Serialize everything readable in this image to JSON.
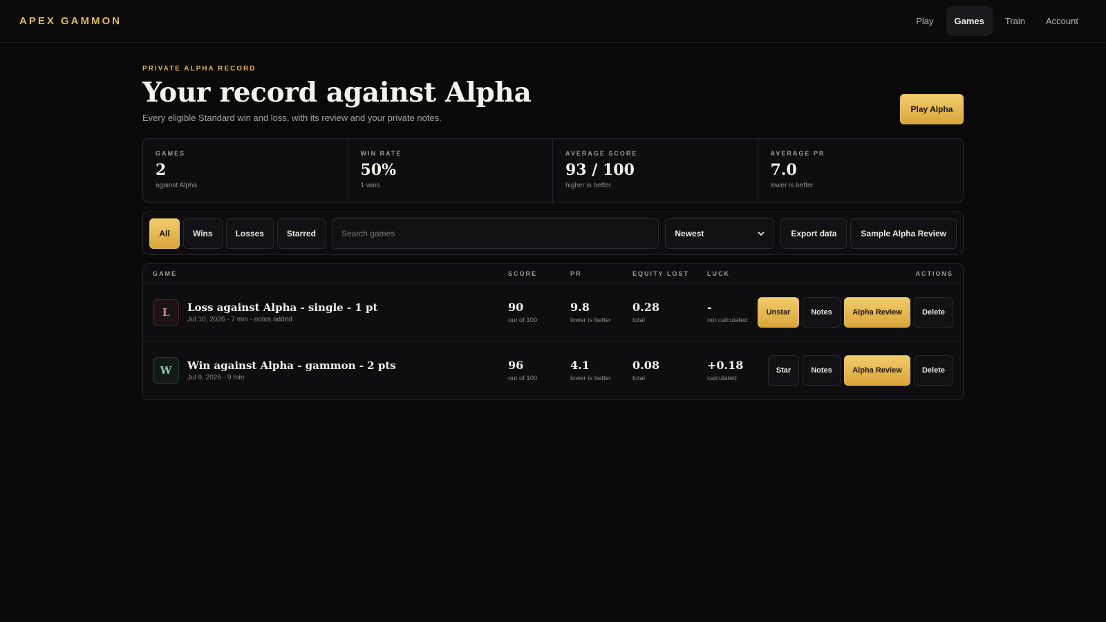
{
  "brand": "APEX GAMMON",
  "nav": [
    "Play",
    "Games",
    "Train",
    "Account"
  ],
  "header": {
    "eyebrow": "PRIVATE ALPHA RECORD",
    "title": "Your record against Alpha",
    "subtitle": "Every eligible Standard win and loss, with its review and your private notes.",
    "play_button": "Play Alpha"
  },
  "stats": [
    {
      "label": "GAMES",
      "value": "2",
      "sub": "against Alpha"
    },
    {
      "label": "WIN RATE",
      "value": "50%",
      "sub": "1 wins"
    },
    {
      "label": "AVERAGE SCORE",
      "value": "93 / 100",
      "sub": "higher is better"
    },
    {
      "label": "AVERAGE PR",
      "value": "7.0",
      "sub": "lower is better"
    }
  ],
  "toolbar": {
    "filters": [
      "All",
      "Wins",
      "Losses",
      "Starred"
    ],
    "search_placeholder": "Search games",
    "sort_value": "Newest",
    "export_label": "Export data",
    "sample_label": "Sample Alpha Review"
  },
  "table": {
    "headers": [
      "GAME",
      "SCORE",
      "PR",
      "EQUITY LOST",
      "LUCK",
      "ACTIONS"
    ],
    "rows": [
      {
        "badge": "L",
        "title": "Loss against Alpha - single - 1 pt",
        "meta": "Jul 10, 2026 - 7 min - notes added",
        "score": "90",
        "score_sub": "out of 100",
        "pr": "9.8",
        "pr_sub": "lower is better",
        "equity": "0.28",
        "equity_sub": "total",
        "luck": "-",
        "luck_sub": "not calculated",
        "star_label": "Unstar",
        "notes_label": "Notes",
        "review_label": "Alpha Review",
        "delete_label": "Delete"
      },
      {
        "badge": "W",
        "title": "Win against Alpha - gammon - 2 pts",
        "meta": "Jul 9, 2026 - 9 min",
        "score": "96",
        "score_sub": "out of 100",
        "pr": "4.1",
        "pr_sub": "lower is better",
        "equity": "0.08",
        "equity_sub": "total",
        "luck": "+0.18",
        "luck_sub": "calculated",
        "star_label": "Star",
        "notes_label": "Notes",
        "review_label": "Alpha Review",
        "delete_label": "Delete"
      }
    ]
  },
  "colors": {
    "accent": "#e4b74f",
    "background": "#09090a",
    "loss": "#d88a7f",
    "win": "#8fc3a2"
  }
}
